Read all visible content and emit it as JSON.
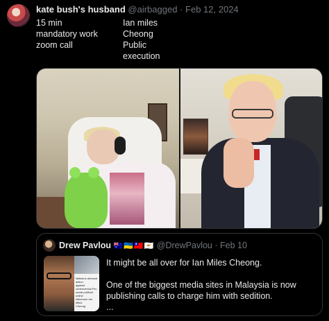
{
  "tweet": {
    "author_name": "kate bush's husband",
    "author_handle": "@airbagged",
    "separator": "·",
    "date": "Feb 12, 2024",
    "left_lines": [
      "15 min",
      "mandatory work",
      "zoom call"
    ],
    "right_lines": [
      "Ian miles",
      "Cheong",
      "Public",
      "execution"
    ]
  },
  "quoted_tweet": {
    "author_name": "Drew Pavlou",
    "flags": "🇦🇺🇺🇦🇹🇼🇨🇾",
    "author_handle": "@DrewPavlou",
    "separator": "·",
    "date": "Feb 10",
    "text": "It might be all over for Ian Miles Cheong.\n\nOne of the biggest media sites in Malaysia is now publishing calls to charge him with sedition.\n...",
    "thumbnail_lines": [
      "Netizens demand action",
      "against controversial Per-",
      "social political online",
      "influencer Ian Miles",
      "Cheong"
    ]
  },
  "icons": {
    "avatar": "author-avatar",
    "quoted_avatar": "quoted-author-avatar"
  },
  "colors": {
    "background": "#000000",
    "text_primary": "#e7e9ea",
    "text_secondary": "#71767b",
    "border": "#2f3336"
  }
}
